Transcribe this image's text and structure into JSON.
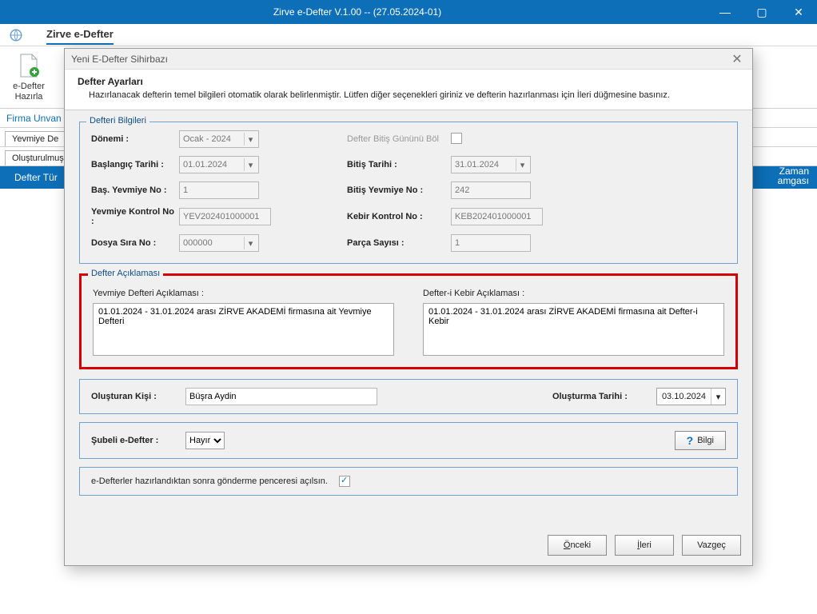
{
  "title_bar": {
    "title": "Zirve e-Defter V.1.00  -- (27.05.2024-01)"
  },
  "subheader": {
    "app_name": "Zirve e-Defter"
  },
  "ribbon": {
    "cmd_label_l1": "e-Defter",
    "cmd_label_l2": "Hazırla"
  },
  "firm_row": "Firma Unvan",
  "tabs": {
    "yevmiye": "Yevmiye De",
    "olusturulmus": "Oluşturulmuş"
  },
  "defter_tur": "Defter Tür",
  "right_badge_l1": "Zaman",
  "right_badge_l2": "amgası",
  "wizard": {
    "window_title": "Yeni E-Defter Sihirbazı",
    "header_title": "Defter Ayarları",
    "header_desc": "Hazırlanacak defterin temel bilgileri otomatik olarak belirlenmiştir. Lütfen diğer seçenekleri giriniz ve defterin hazırlanması için İleri düğmesine basınız.",
    "defteri_bilgileri_title": "Defteri Bilgileri",
    "fields": {
      "donemi_l": "Dönemi :",
      "donemi_v": "Ocak - 2024",
      "bitisbol_l": "Defter Bitiş Gününü Böl",
      "baslangic_l": "Başlangıç Tarihi :",
      "baslangic_v": "01.01.2024",
      "bitis_l": "Bitiş Tarihi :",
      "bitis_v": "31.01.2024",
      "basyev_l": "Baş. Yevmiye No :",
      "basyev_v": "1",
      "bitisyev_l": "Bitiş Yevmiye No :",
      "bitisyev_v": "242",
      "yevkont_l": "Yevmiye Kontrol No :",
      "yevkont_v": "YEV202401000001",
      "kebkont_l": "Kebir Kontrol No :",
      "kebkont_v": "KEB202401000001",
      "dosyano_l": "Dosya Sıra No :",
      "dosyano_v": "000000",
      "parca_l": "Parça Sayısı :",
      "parca_v": "1"
    },
    "aciklama": {
      "title": "Defter Açıklaması",
      "yev_l": "Yevmiye Defteri Açıklaması :",
      "yev_v": "01.01.2024 - 31.01.2024 arası ZİRVE AKADEMİ firmasına ait Yevmiye Defteri",
      "keb_l": "Defter-i Kebir Açıklaması :",
      "keb_v": "01.01.2024 - 31.01.2024 arası ZİRVE AKADEMİ firmasına ait Defter-i Kebir"
    },
    "creator": {
      "olusturan_l": "Oluşturan Kişi :",
      "olusturan_v": "Büşra Aydin",
      "tarih_l": "Oluşturma Tarihi :",
      "tarih_v": "03.10.2024"
    },
    "subeli": {
      "label": "Şubeli e-Defter :",
      "value": "Hayır",
      "bilgi": "Bilgi"
    },
    "sendafter": "e-Defterler hazırlandıktan sonra gönderme penceresi açılsın.",
    "buttons": {
      "onceki": "Önceki",
      "ileri": "İleri",
      "vazgec": "Vazgeç"
    }
  }
}
